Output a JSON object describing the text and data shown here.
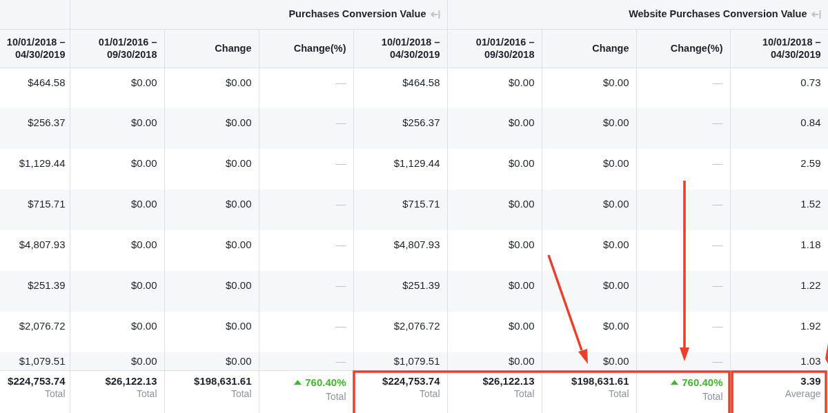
{
  "table": {
    "groups": [
      {
        "label": "Purchases Conversion Value"
      },
      {
        "label": "Website Purchases Conversion Value"
      }
    ],
    "columns": [
      "10/01/2018 –\n04/30/2019",
      "01/01/2016 –\n09/30/2018",
      "Change",
      "Change(%)",
      "10/01/2018 –\n04/30/2019",
      "01/01/2016 –\n09/30/2018",
      "Change",
      "Change(%)",
      "10/01/2018 –\n04/30/2019"
    ],
    "rows": [
      [
        "$464.58",
        "$0.00",
        "$0.00",
        "—",
        "$464.58",
        "$0.00",
        "$0.00",
        "—",
        "0.73"
      ],
      [
        "$256.37",
        "$0.00",
        "$0.00",
        "—",
        "$256.37",
        "$0.00",
        "$0.00",
        "—",
        "0.84"
      ],
      [
        "$1,129.44",
        "$0.00",
        "$0.00",
        "—",
        "$1,129.44",
        "$0.00",
        "$0.00",
        "—",
        "2.59"
      ],
      [
        "$715.71",
        "$0.00",
        "$0.00",
        "—",
        "$715.71",
        "$0.00",
        "$0.00",
        "—",
        "1.52"
      ],
      [
        "$4,807.93",
        "$0.00",
        "$0.00",
        "—",
        "$4,807.93",
        "$0.00",
        "$0.00",
        "—",
        "1.18"
      ],
      [
        "$251.39",
        "$0.00",
        "$0.00",
        "—",
        "$251.39",
        "$0.00",
        "$0.00",
        "—",
        "1.22"
      ],
      [
        "$2,076.72",
        "$0.00",
        "$0.00",
        "—",
        "$2,076.72",
        "$0.00",
        "$0.00",
        "—",
        "1.92"
      ],
      [
        "$1,079.51",
        "$0.00",
        "$0.00",
        "—",
        "$1,079.51",
        "$0.00",
        "$0.00",
        "—",
        "1.03"
      ]
    ],
    "footer": [
      {
        "value": "$224,753.74",
        "label": "Total",
        "rising": false
      },
      {
        "value": "$26,122.13",
        "label": "Total",
        "rising": false
      },
      {
        "value": "$198,631.61",
        "label": "Total",
        "rising": false
      },
      {
        "value": "760.40%",
        "label": "Total",
        "rising": true
      },
      {
        "value": "$224,753.74",
        "label": "Total",
        "rising": false
      },
      {
        "value": "$26,122.13",
        "label": "Total",
        "rising": false
      },
      {
        "value": "$198,631.61",
        "label": "Total",
        "rising": false
      },
      {
        "value": "760.40%",
        "label": "Total",
        "rising": true
      },
      {
        "value": "3.39",
        "label": "Average",
        "rising": false
      }
    ]
  }
}
